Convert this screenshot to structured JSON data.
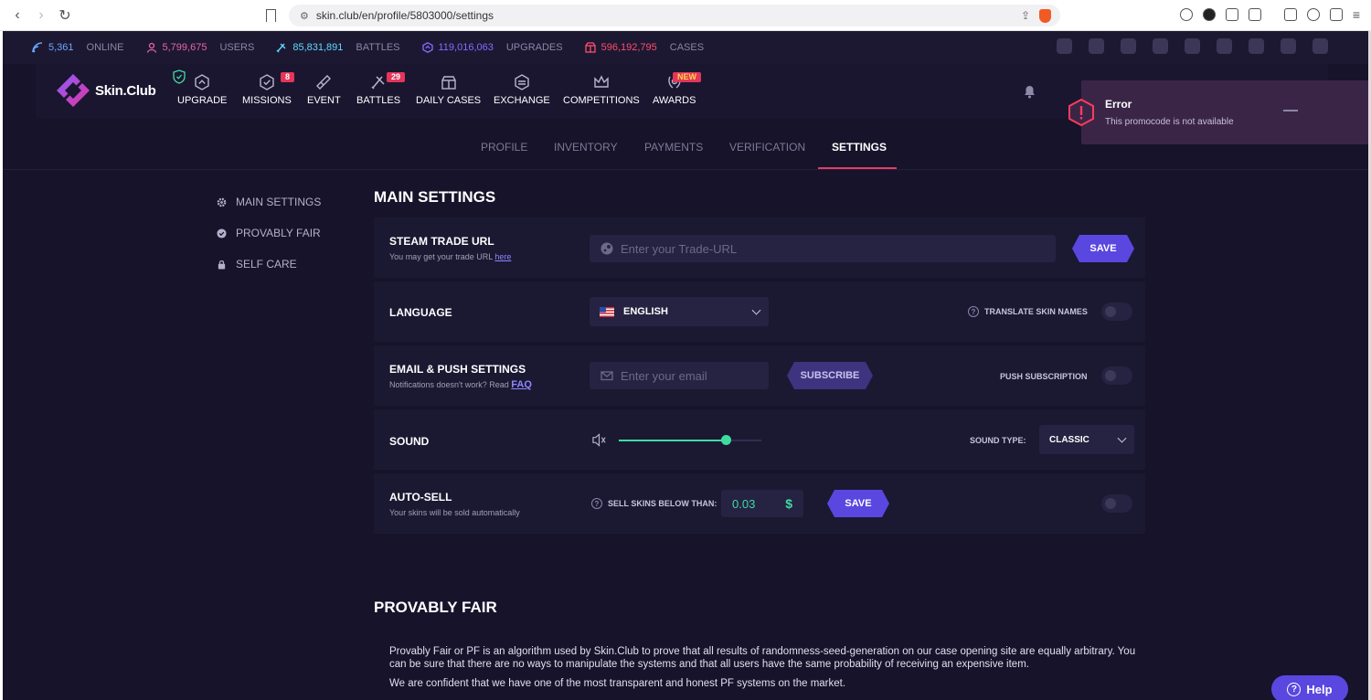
{
  "browser": {
    "url": "skin.club/en/profile/5803000/settings"
  },
  "stats": [
    {
      "value": "5,361",
      "label": "ONLINE",
      "color": "#6aa8ff"
    },
    {
      "value": "5,799,675",
      "label": "USERS",
      "color": "#e864a8"
    },
    {
      "value": "85,831,891",
      "label": "BATTLES",
      "color": "#5fd8ff"
    },
    {
      "value": "119,016,063",
      "label": "UPGRADES",
      "color": "#8a6aff"
    },
    {
      "value": "596,192,795",
      "label": "CASES",
      "color": "#ff4d6b"
    }
  ],
  "brand": {
    "name": "Skin.Club"
  },
  "nav": [
    {
      "label": "UPGRADE",
      "icon": "upgrade-icon"
    },
    {
      "label": "MISSIONS",
      "icon": "missions-icon",
      "badge": "8"
    },
    {
      "label": "EVENT",
      "icon": "event-icon"
    },
    {
      "label": "BATTLES",
      "icon": "battles-icon",
      "badge": "29"
    },
    {
      "label": "DAILY CASES",
      "icon": "daily-cases-icon"
    },
    {
      "label": "EXCHANGE",
      "icon": "exchange-icon"
    },
    {
      "label": "COMPETITIONS",
      "icon": "competitions-icon"
    },
    {
      "label": "AWARDS",
      "icon": "awards-icon",
      "badge": "NEW"
    }
  ],
  "toast": {
    "title": "Error",
    "message": "This promocode is not available"
  },
  "tabs": [
    "PROFILE",
    "INVENTORY",
    "PAYMENTS",
    "VERIFICATION",
    "SETTINGS"
  ],
  "active_tab": "SETTINGS",
  "side_menu": [
    "MAIN SETTINGS",
    "PROVABLY FAIR",
    "SELF CARE"
  ],
  "main_settings": {
    "title": "MAIN SETTINGS",
    "trade": {
      "label": "STEAM TRADE URL",
      "sub": "You may get your trade URL ",
      "sub_link": "here",
      "placeholder": "Enter your Trade-URL",
      "save": "SAVE"
    },
    "language": {
      "label": "LANGUAGE",
      "value": "ENGLISH",
      "translate_label": "TRANSLATE SKIN NAMES"
    },
    "email": {
      "label": "EMAIL & PUSH SETTINGS",
      "sub": "Notifications doesn't work? Read ",
      "sub_link": "FAQ",
      "placeholder": "Enter your email",
      "subscribe": "SUBSCRIBE",
      "push_label": "PUSH SUBSCRIPTION"
    },
    "sound": {
      "label": "SOUND",
      "volume": 0.75,
      "type_label": "SOUND TYPE:",
      "type_value": "CLASSIC"
    },
    "autosell": {
      "label": "AUTO-SELL",
      "sub": "Your skins will be sold automatically",
      "below_label": "SELL SKINS BELOW THAN:",
      "value": "0.03",
      "currency": "$",
      "save": "SAVE"
    }
  },
  "provably_fair": {
    "title": "PROVABLY FAIR",
    "p1": "Provably Fair or PF is an algorithm used by Skin.Club to prove that all results of randomness-seed-generation on our case opening site are equally arbitrary. You can be sure that there are no ways to manipulate the systems and that all users have the same probability of receiving an expensive item.",
    "p2": "We are confident that we have one of the most transparent and honest PF systems on the market."
  },
  "help": {
    "label": "Help"
  },
  "colors": {
    "accent": "#5a47e0",
    "active_tab_underline": "#e23d63",
    "slider": "#3fdca0",
    "background": "#16132a"
  }
}
